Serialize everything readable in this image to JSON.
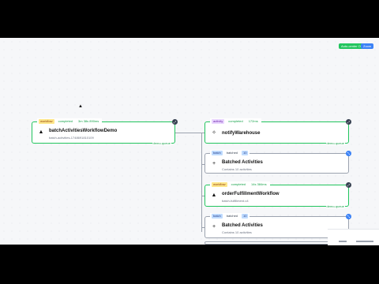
{
  "toolbar": {
    "green_button_label": "Auto-center On",
    "blue_button_label": "Zoom"
  },
  "root": {
    "kind": "workflow",
    "status": "completed",
    "duration": "3m 38s 890ms",
    "title": "batchActivitiesWorkflowDemo",
    "subtitle": "batch-activities-1748691810109",
    "queue": "demo-queue"
  },
  "nodes": [
    {
      "kind": "activity",
      "status": "completed",
      "duration": "172ms",
      "title": "notifyWarehouse",
      "subtitle": "",
      "queue": "demo-queue"
    },
    {
      "kind": "batch",
      "status": "batched",
      "count": "10",
      "title": "Batched Activities",
      "subtitle": "Contains 10 activities",
      "queue": ""
    },
    {
      "kind": "workflow",
      "status": "completed",
      "duration": "14s 384ms",
      "title": "orderFulfillmentWorkflow",
      "subtitle": "batch-fulfillment-v4",
      "queue": "demo-queue"
    },
    {
      "kind": "batch",
      "status": "batched",
      "count": "10",
      "title": "Batched Activities",
      "subtitle": "Contains 10 activities",
      "queue": ""
    }
  ],
  "icons": {
    "workflow": "workflow-icon",
    "activity": "activity-icon",
    "batch": "batch-plus-icon",
    "expand": "expand-icon",
    "collapse": "collapse-icon"
  }
}
